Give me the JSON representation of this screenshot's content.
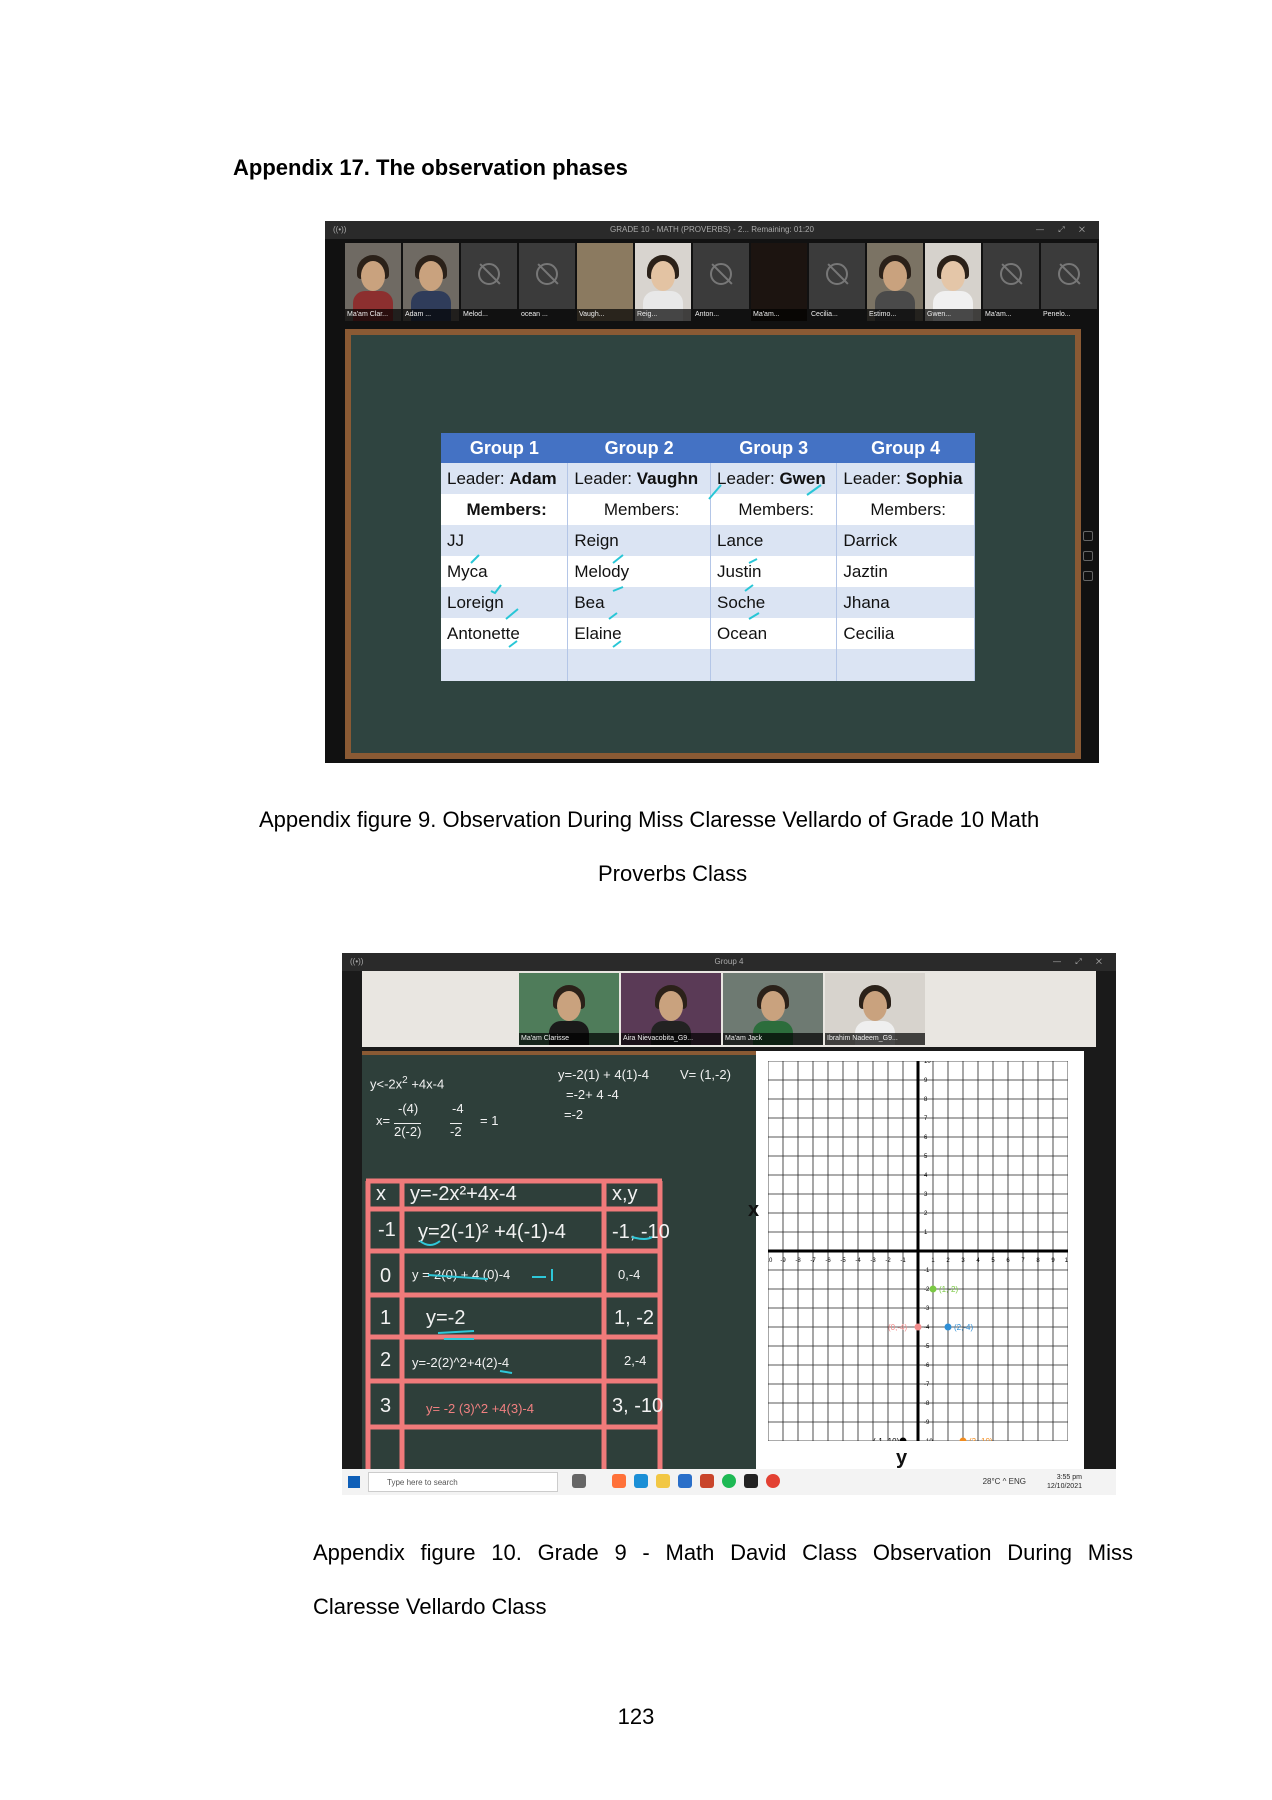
{
  "heading": "Appendix 17. The observation phases",
  "figure9": {
    "window_title": "GRADE 10 - MATH (PROVERBS) - 2...   Remaining: 01:20",
    "participants": [
      "Ma'am Clar...",
      "Adam ...",
      "Melod...",
      "ocean ...",
      "Vaugh...",
      "Reig...",
      "Anton...",
      "Ma'am...",
      "Cecilia...",
      "Estimo...",
      "Gwen...",
      "Ma'am...",
      "Penelo..."
    ],
    "groups": [
      "Group 1",
      "Group 2",
      "Group 3",
      "Group 4"
    ],
    "leader_label": "Leader:",
    "leaders": [
      "Adam",
      "Vaughn",
      "Gwen",
      "Sophia"
    ],
    "members_label": "Members:",
    "members": [
      [
        "JJ",
        "Reign",
        "Lance",
        "Darrick"
      ],
      [
        "Myca",
        "Melody",
        "Justin",
        "Jaztin"
      ],
      [
        "Loreign",
        "Bea",
        "Soche",
        "Jhana"
      ],
      [
        "Antonette",
        "Elaine",
        "Ocean",
        "Cecilia"
      ]
    ]
  },
  "caption9_line1": "Appendix figure 9. Observation During Miss Claresse Vellardo of Grade 10 Math",
  "caption9_line2": "Proverbs Class",
  "figure10": {
    "window_title": "Group 4",
    "participants": [
      "Ma'am Clarisse",
      "Aira Nievacobita_G9...",
      "Ma'am Jack",
      "Ibrahim Nadeem_G9..."
    ],
    "board_work": {
      "eq1": "y<-2x",
      "eq1_exp": "2",
      "eq1_rest": "+4x-4",
      "x_label": "x=",
      "frac1_num": "-(4)",
      "frac1_den": "2(-2)",
      "frac2_num": "-4",
      "frac2_den": "-2",
      "eq_one": "= 1",
      "calc1": "y=-2(1) + 4(1)-4",
      "calc2": "=-2+ 4 -4",
      "calc3": "=-2",
      "vertex": "V= (1,-2)"
    },
    "table_headers": [
      "x",
      "y=-2x²+4x-4",
      "x,y"
    ],
    "table_rows": [
      [
        "-1",
        "y=2(-1)² +4(-1)-4",
        "-1, -10"
      ],
      [
        "0",
        "y =-2(0) + 4 (0)-4",
        "0,-4"
      ],
      [
        "1",
        "y=-2",
        "1, -2"
      ],
      [
        "2",
        "y=-2(2)^2+4(2)-4",
        "2,-4"
      ],
      [
        "3",
        "y= -2 (3)^2 +4(3)-4",
        "3, -10"
      ]
    ],
    "axis_x": "x",
    "axis_y": "y",
    "point_labels": [
      "(1,-2)",
      "(0,-4)",
      "(2,-4)",
      "(-1,-10)",
      "(3,-10)"
    ],
    "taskbar_search": "Type here to search",
    "weather": "28°C",
    "lang": "ENG",
    "time": "3:55 pm",
    "date": "12/10/2021"
  },
  "caption10_line1": "Appendix figure 10. Grade 9 - Math David Class Observation During Miss",
  "caption10_line2": "Claresse Vellardo Class",
  "page_number": "123"
}
